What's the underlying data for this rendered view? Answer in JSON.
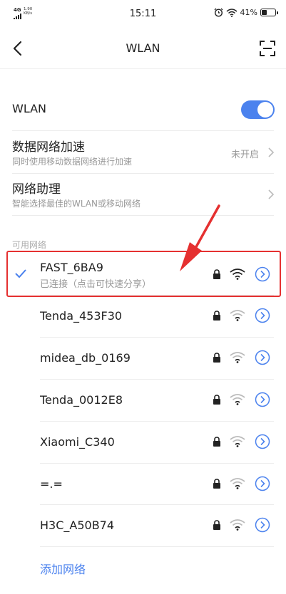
{
  "status_bar": {
    "network": "4G",
    "speed_value": "1.90",
    "speed_unit": "KB/s",
    "time": "15:11",
    "battery": "41%",
    "battery_level": 0.41,
    "icons": [
      "alarm-icon",
      "wifi-icon",
      "battery-icon"
    ]
  },
  "header": {
    "title": "WLAN",
    "back_icon": "chevron-left-icon",
    "scan_icon": "scan-icon"
  },
  "wlan_toggle": {
    "label": "WLAN",
    "on": true
  },
  "settings": [
    {
      "title": "数据网络加速",
      "subtitle": "同时使用移动数据网络进行加速",
      "value": "未开启"
    },
    {
      "title": "网络助理",
      "subtitle": "智能选择最佳的WLAN或移动网络",
      "value": ""
    }
  ],
  "available_label": "可用网络",
  "networks": [
    {
      "ssid": "FAST_6BA9",
      "status": "已连接（点击可快速分享）",
      "connected": true,
      "locked": true
    },
    {
      "ssid": "Tenda_453F30",
      "status": "",
      "connected": false,
      "locked": true
    },
    {
      "ssid": "midea_db_0169",
      "status": "",
      "connected": false,
      "locked": true
    },
    {
      "ssid": "Tenda_0012E8",
      "status": "",
      "connected": false,
      "locked": true
    },
    {
      "ssid": "Xiaomi_C340",
      "status": "",
      "connected": false,
      "locked": true
    },
    {
      "ssid": "=.=",
      "status": "",
      "connected": false,
      "locked": true
    },
    {
      "ssid": "H3C_A50B74",
      "status": "",
      "connected": false,
      "locked": true
    }
  ],
  "add_network": "添加网络",
  "colors": {
    "accent": "#4b82ee",
    "annotation": "#e53030",
    "secondary_text": "#999999"
  }
}
